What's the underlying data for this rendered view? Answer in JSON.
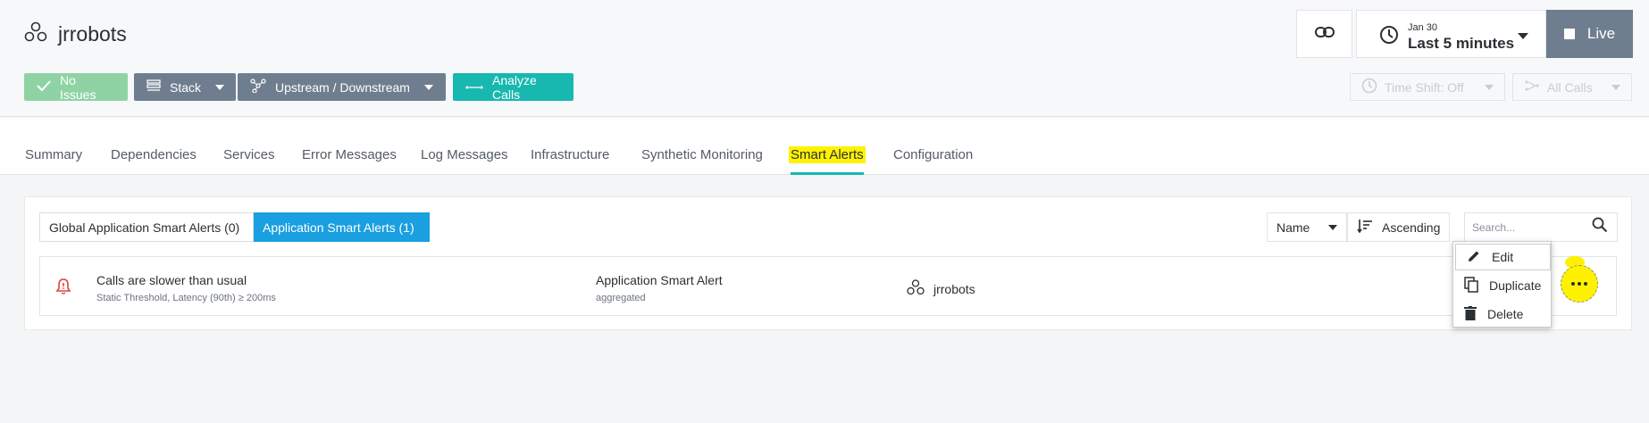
{
  "header": {
    "app_title": "jrrobots",
    "status_label": "No Issues",
    "stack_label": "Stack",
    "upstream_label": "Upstream / Downstream",
    "analyze_label": "Analyze Calls",
    "time": {
      "date": "Jan 30",
      "range": "Last 5 minutes"
    },
    "live_label": "Live",
    "timeshift_label": "Time Shift: Off",
    "allcalls_label": "All Calls"
  },
  "tabs": [
    {
      "label": "Summary"
    },
    {
      "label": "Dependencies"
    },
    {
      "label": "Services"
    },
    {
      "label": "Error Messages"
    },
    {
      "label": "Log Messages"
    },
    {
      "label": "Infrastructure"
    },
    {
      "label": "Synthetic Monitoring"
    },
    {
      "label": "Smart Alerts",
      "active": true
    },
    {
      "label": "Configuration"
    }
  ],
  "alerts_panel": {
    "global_tab": "Global Application Smart Alerts (0)",
    "app_tab": "Application Smart Alerts (1)",
    "sort_field": "Name",
    "sort_order": "Ascending",
    "search_placeholder": "Search...",
    "rows": [
      {
        "name": "Calls are slower than usual",
        "detail": "Static Threshold, Latency (90th) ≥ 200ms",
        "type": "Application Smart Alert",
        "type_sub": "aggregated",
        "application": "jrrobots"
      }
    ]
  },
  "context_menu": {
    "items": [
      {
        "label": "Edit",
        "icon": "pencil-icon"
      },
      {
        "label": "Duplicate",
        "icon": "copy-icon"
      },
      {
        "label": "Delete",
        "icon": "trash-icon"
      }
    ]
  },
  "colors": {
    "accent_teal": "#17b8b0",
    "selected_blue": "#1a9fe0",
    "no_issues_green": "#8fd3a5",
    "button_gray": "#6f7e8f",
    "highlight_yellow": "#fff200",
    "alert_red": "#e0443b"
  }
}
